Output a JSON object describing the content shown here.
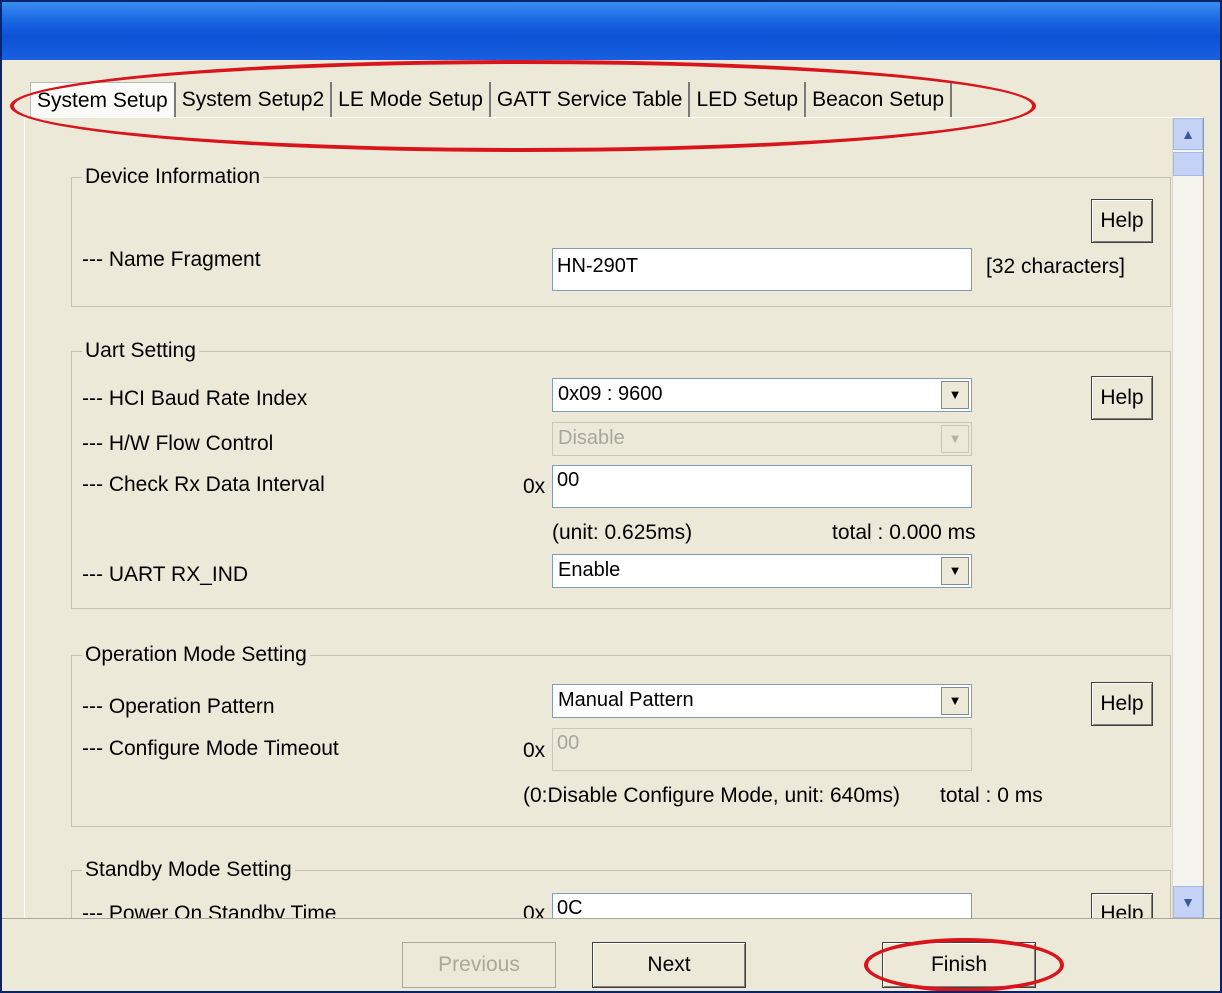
{
  "tabs": [
    "System Setup",
    "System Setup2",
    "LE Mode Setup",
    "GATT Service Table",
    "LED Setup",
    "Beacon Setup"
  ],
  "device_info": {
    "title": "Device Information",
    "help": "Help",
    "name_label": "--- Name Fragment",
    "name_value": "HN-290T",
    "name_hint": "[32 characters]"
  },
  "uart": {
    "title": "Uart Setting",
    "baud_label": "--- HCI Baud Rate Index",
    "baud_value": "0x09 : 9600",
    "help": "Help",
    "flow_label": "--- H/W Flow Control",
    "flow_value": "Disable",
    "rx_label": "--- Check Rx Data Interval",
    "rx_prefix": "0x",
    "rx_value": "00",
    "rx_unit": "(unit: 0.625ms)",
    "rx_total": "total : 0.000 ms",
    "rxind_label": "--- UART RX_IND",
    "rxind_value": "Enable"
  },
  "operation": {
    "title": "Operation Mode Setting",
    "pattern_label": "--- Operation Pattern",
    "pattern_value": "Manual Pattern",
    "help": "Help",
    "timeout_label": "--- Configure Mode Timeout",
    "timeout_prefix": "0x",
    "timeout_value": "00",
    "timeout_note": "(0:Disable Configure Mode, unit: 640ms)",
    "timeout_total": "total : 0 ms"
  },
  "standby": {
    "title": "Standby Mode Setting",
    "time_label": "--- Power On Standby Time",
    "time_prefix": "0x",
    "time_value": "0C",
    "help": "Help"
  },
  "footer": {
    "previous": "Previous",
    "next": "Next",
    "finish": "Finish"
  },
  "icons": {
    "scroll_up": "chevron-up-icon",
    "scroll_down": "chevron-down-icon",
    "dropdown": "down-arrow-icon"
  },
  "annotation_color": "#d9141b"
}
